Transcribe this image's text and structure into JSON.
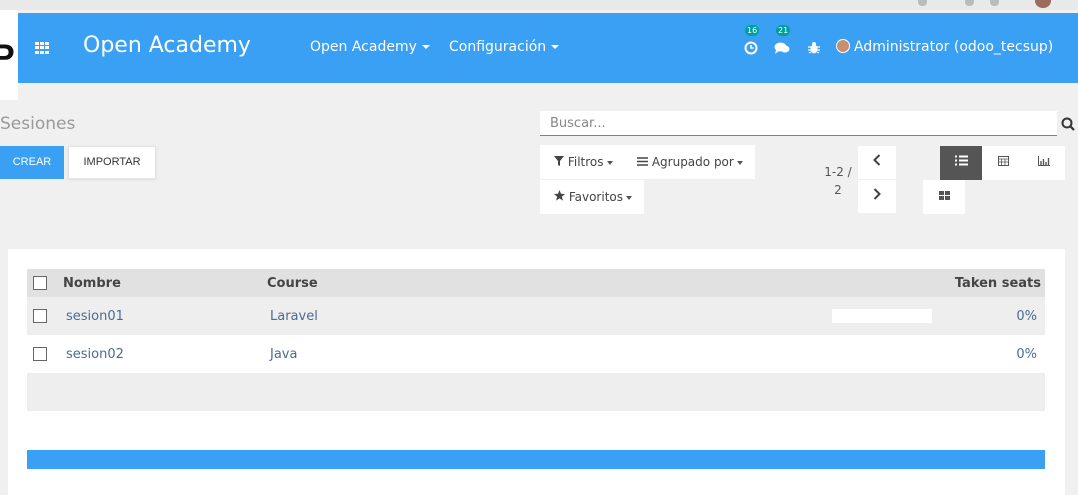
{
  "navbar": {
    "brand": "Open Academy",
    "menu": [
      {
        "label": "Open Academy"
      },
      {
        "label": "Configuración"
      }
    ],
    "activity_badge": "16",
    "messages_badge": "21",
    "user": "Administrator (odoo_tecsup)",
    "color": "#3aa0f3"
  },
  "page": {
    "title": "Sesiones",
    "create_label": "CREAR",
    "import_label": "IMPORTAR"
  },
  "search": {
    "placeholder": "Buscar..."
  },
  "filters": {
    "filtros": "Filtros",
    "agrupado": "Agrupado por",
    "favoritos": "Favoritos"
  },
  "pager": {
    "range": "1-2 /",
    "total": "2"
  },
  "views": [
    "list-icon",
    "calendar-icon",
    "graph-icon",
    "kanban-icon"
  ],
  "table": {
    "headers": {
      "name": "Nombre",
      "course": "Course",
      "seats": "Taken seats"
    },
    "rows": [
      {
        "name": "sesion01",
        "course": "Laravel",
        "taken_seats": "0%",
        "progress": 0
      },
      {
        "name": "sesion02",
        "course": "Java",
        "taken_seats": "0%",
        "progress": 0
      }
    ]
  },
  "colors": {
    "accent": "#3aa0f3",
    "active_view": "#555555",
    "link": "#4a6b95"
  }
}
